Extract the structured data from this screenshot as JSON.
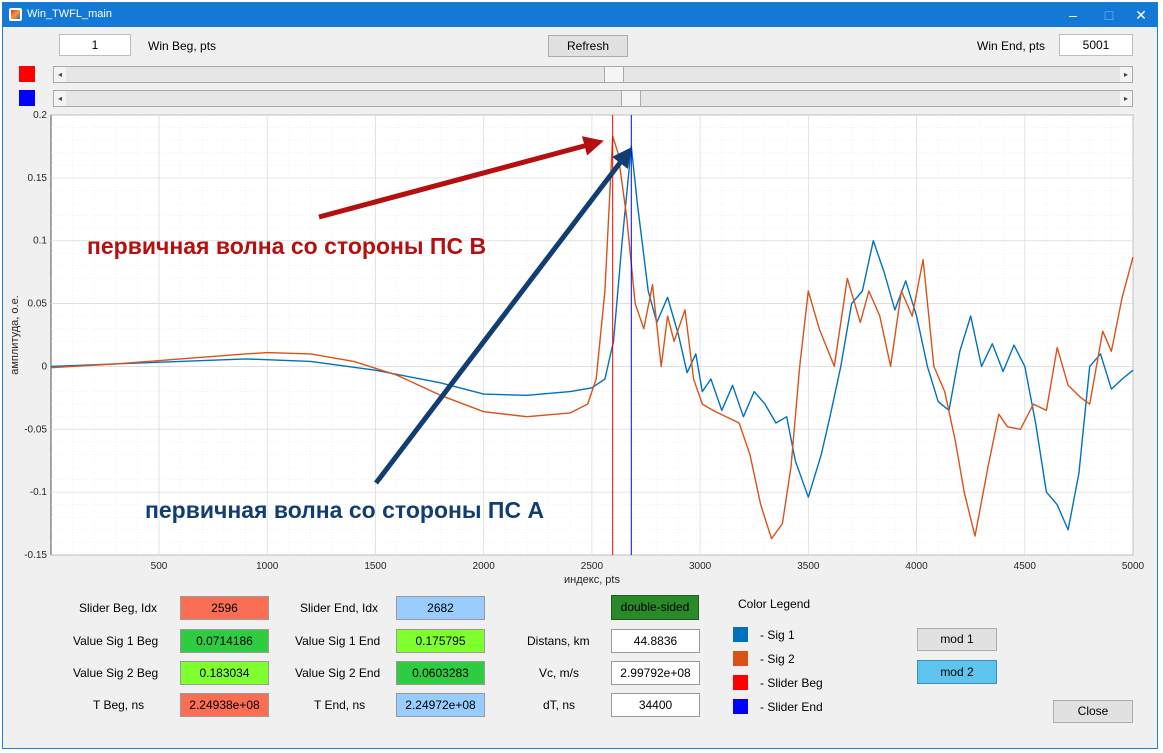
{
  "window": {
    "title": "Win_TWFL_main",
    "minimize": "–",
    "maximize": "□",
    "close": "✕"
  },
  "top": {
    "win_beg_value": "1",
    "win_beg_label": "Win Beg, pts",
    "refresh": "Refresh",
    "win_end_label": "Win End, pts",
    "win_end_value": "5001"
  },
  "sliders": {
    "red_color": "#ff0000",
    "blue_color": "#0000ff",
    "left_arrow": "◂",
    "right_arrow": "▸",
    "red_fraction": 0.519,
    "blue_fraction": 0.536
  },
  "annotations": {
    "red_text": "первичная волна со стороны ПС В",
    "blue_text": "первичная волна со стороны ПС А",
    "red_color": "#b50f0f",
    "blue_color": "#123d73"
  },
  "chart_data": {
    "type": "line",
    "xlabel": "индекс, pts",
    "ylabel": "амплитуда, о.е.",
    "xlim": [
      1,
      5000
    ],
    "ylim": [
      -0.15,
      0.2
    ],
    "xticks": [
      500,
      1000,
      1500,
      2000,
      2500,
      3000,
      3500,
      4000,
      4500,
      5000
    ],
    "yticks": [
      -0.15,
      -0.1,
      -0.05,
      0,
      0.05,
      0.1,
      0.15,
      0.2
    ],
    "ytick_labels": [
      "-0.15",
      "-0.1",
      "-0.05",
      "0",
      "0.05",
      "0.1",
      "0.15",
      "0.2"
    ],
    "grid": true,
    "vlines": [
      {
        "x": 2596,
        "color": "#ff0000"
      },
      {
        "x": 2682,
        "color": "#0000ff"
      }
    ],
    "series": [
      {
        "color": "#0072bd",
        "x": [
          1,
          300,
          600,
          900,
          1200,
          1500,
          1800,
          2000,
          2200,
          2400,
          2500,
          2560,
          2600,
          2640,
          2682,
          2710,
          2760,
          2800,
          2850,
          2900,
          2940,
          2980,
          3010,
          3050,
          3100,
          3150,
          3200,
          3250,
          3300,
          3350,
          3400,
          3440,
          3500,
          3560,
          3600,
          3650,
          3700,
          3750,
          3800,
          3850,
          3900,
          3950,
          4000,
          4050,
          4100,
          4150,
          4200,
          4250,
          4300,
          4350,
          4400,
          4450,
          4500,
          4550,
          4600,
          4650,
          4700,
          4750,
          4800,
          4850,
          4900,
          4950,
          5000
        ],
        "y": [
          0,
          0.002,
          0.004,
          0.006,
          0.004,
          -0.003,
          -0.013,
          -0.022,
          -0.023,
          -0.02,
          -0.017,
          -0.01,
          0.02,
          0.1,
          0.175,
          0.13,
          0.06,
          0.035,
          0.055,
          0.025,
          -0.005,
          0.01,
          -0.02,
          -0.01,
          -0.035,
          -0.015,
          -0.04,
          -0.02,
          -0.03,
          -0.045,
          -0.04,
          -0.075,
          -0.104,
          -0.07,
          -0.04,
          0.0,
          0.05,
          0.06,
          0.1,
          0.075,
          0.045,
          0.068,
          0.04,
          0.0,
          -0.028,
          -0.035,
          0.012,
          0.04,
          0.0,
          0.018,
          -0.004,
          0.017,
          0.0,
          -0.045,
          -0.1,
          -0.11,
          -0.13,
          -0.085,
          0.0,
          0.01,
          -0.018,
          -0.01,
          -0.003
        ]
      },
      {
        "color": "#d95319",
        "x": [
          1,
          300,
          600,
          900,
          1000,
          1200,
          1400,
          1600,
          1800,
          2000,
          2200,
          2400,
          2480,
          2520,
          2560,
          2596,
          2620,
          2660,
          2700,
          2740,
          2780,
          2820,
          2850,
          2880,
          2930,
          2970,
          3010,
          3060,
          3120,
          3180,
          3230,
          3280,
          3330,
          3380,
          3420,
          3460,
          3500,
          3550,
          3620,
          3680,
          3740,
          3780,
          3830,
          3880,
          3930,
          3980,
          4030,
          4080,
          4130,
          4180,
          4220,
          4270,
          4330,
          4380,
          4420,
          4480,
          4540,
          4600,
          4650,
          4700,
          4760,
          4800,
          4860,
          4900,
          4950,
          5000
        ],
        "y": [
          -0.001,
          0.002,
          0.006,
          0.01,
          0.011,
          0.01,
          0.004,
          -0.007,
          -0.023,
          -0.036,
          -0.04,
          -0.037,
          -0.03,
          -0.01,
          0.06,
          0.183,
          0.17,
          0.12,
          0.05,
          0.03,
          0.065,
          0.0,
          0.04,
          0.02,
          0.045,
          -0.01,
          -0.03,
          -0.035,
          -0.04,
          -0.045,
          -0.07,
          -0.11,
          -0.137,
          -0.125,
          -0.08,
          0.0,
          0.06,
          0.03,
          0.0,
          0.07,
          0.035,
          0.06,
          0.04,
          0.0,
          0.06,
          0.04,
          0.085,
          0.0,
          -0.02,
          -0.06,
          -0.1,
          -0.135,
          -0.08,
          -0.038,
          -0.048,
          -0.05,
          -0.03,
          -0.035,
          0.015,
          -0.015,
          -0.025,
          -0.03,
          0.028,
          0.012,
          0.055,
          0.087
        ]
      }
    ]
  },
  "info": {
    "slider_beg_label": "Slider Beg, Idx",
    "slider_beg_value": "2596",
    "slider_end_label": "Slider End, Idx",
    "slider_end_value": "2682",
    "val_sig1_beg_label": "Value Sig 1 Beg",
    "val_sig1_beg": "0.0714186",
    "val_sig1_end_label": "Value Sig 1 End",
    "val_sig1_end": "0.175795",
    "val_sig2_beg_label": "Value Sig 2 Beg",
    "val_sig2_beg": "0.183034",
    "val_sig2_end_label": "Value Sig 2 End",
    "val_sig2_end": "0.0603283",
    "t_beg_label": "T Beg, ns",
    "t_beg": "2.24938e+08",
    "t_end_label": "T End, ns",
    "t_end": "2.24972e+08",
    "double_sided": "double-sided",
    "distans_label": "Distans, km",
    "distans": "44.8836",
    "vc_label": "Vc, m/s",
    "vc": "2.99792e+08",
    "dt_label": "dT, ns",
    "dt": "34400"
  },
  "legend": {
    "title": "Color Legend",
    "items": [
      {
        "label": "- Sig 1",
        "color": "#0072bd"
      },
      {
        "label": "- Sig 2",
        "color": "#d95319"
      },
      {
        "label": "- Slider Beg",
        "color": "#ff0000"
      },
      {
        "label": "- Slider End",
        "color": "#0000ff"
      }
    ]
  },
  "buttons": {
    "mod1": "mod 1",
    "mod2": "mod 2",
    "close": "Close"
  },
  "colors": {
    "red_box": "#fa6e54",
    "blue_box": "#99ccff",
    "green_dark": "#2ecc40",
    "green_light": "#7fff2e",
    "double_sided_bg": "#2a8a2a",
    "mod2_bg": "#5ec4ee"
  }
}
